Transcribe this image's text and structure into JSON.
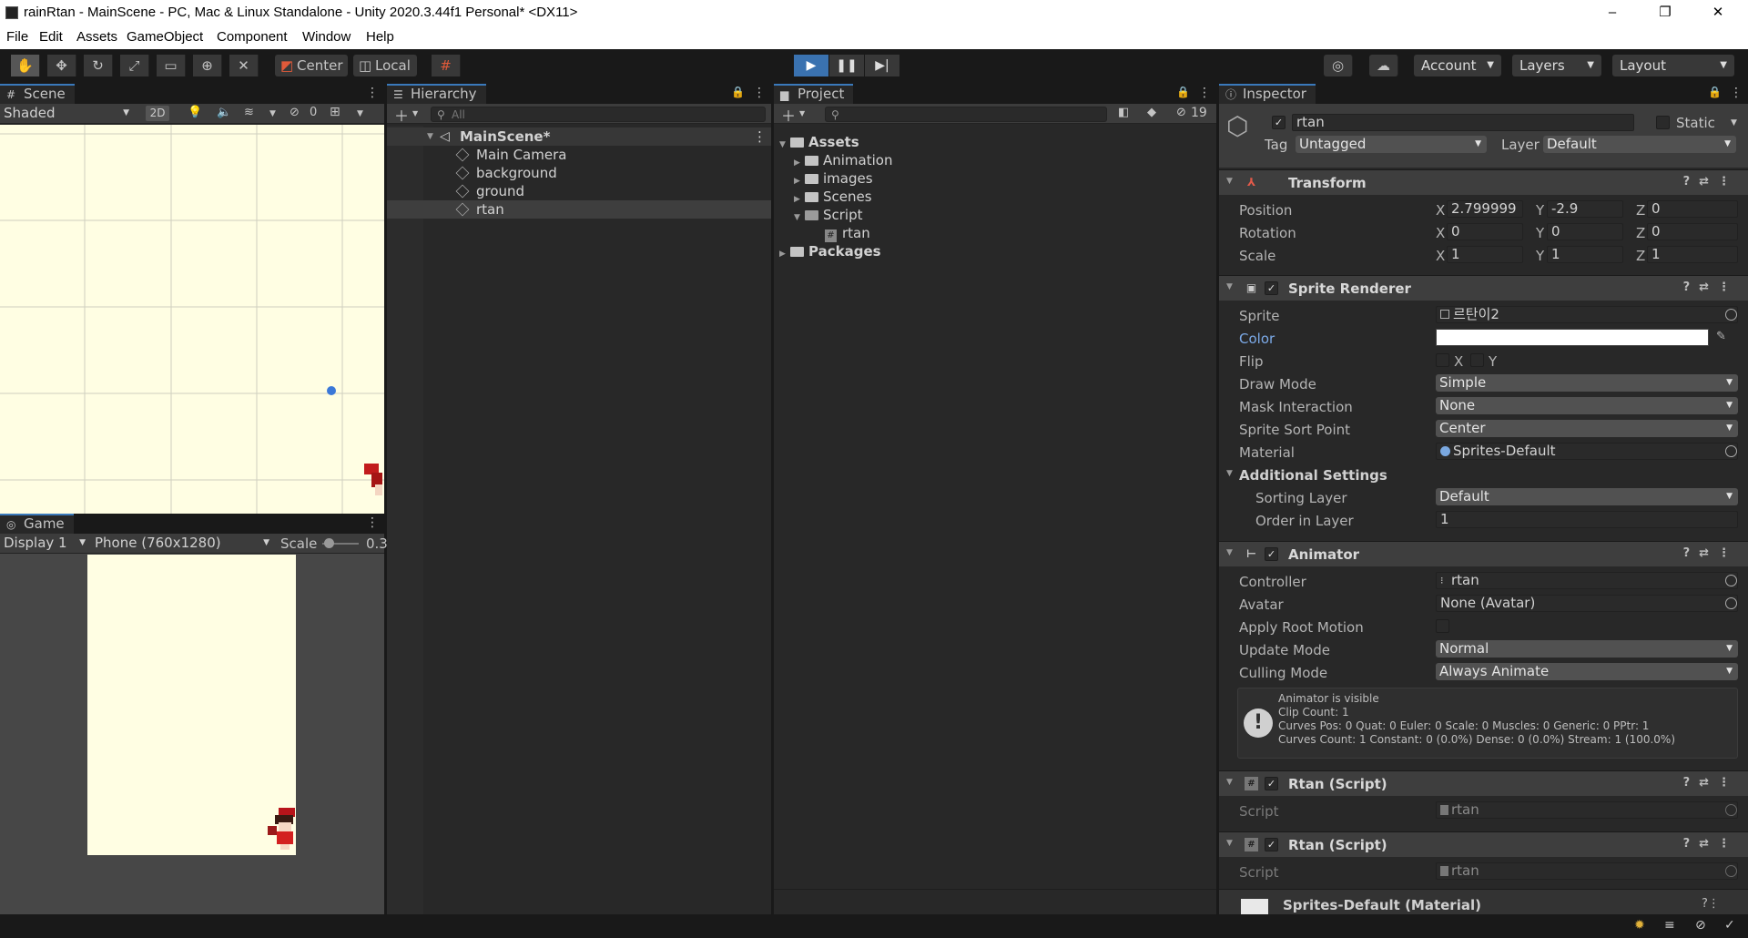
{
  "window": {
    "title": "rainRtan - MainScene - PC, Mac & Linux Standalone - Unity 2020.3.44f1 Personal* <DX11>",
    "minimize": "–",
    "maximize": "❐",
    "close": "✕"
  },
  "menu": [
    "File",
    "Edit",
    "Assets",
    "GameObject",
    "Component",
    "Window",
    "Help"
  ],
  "toolbar": {
    "pivot_center": "Center",
    "pivot_local": "Local",
    "account": "Account",
    "layers": "Layers",
    "layout": "Layout"
  },
  "scene": {
    "tab": "Scene",
    "shading": "Shaded",
    "mode_2d": "2D",
    "hidden_count": "0",
    "bg_color": "#fffee3"
  },
  "game": {
    "tab": "Game",
    "display": "Display 1",
    "resolution": "Phone (760x1280)",
    "scale_label": "Scale",
    "scale_value": "0.3"
  },
  "hierarchy": {
    "tab": "Hierarchy",
    "search_placeholder": "All",
    "scene_name": "MainScene*",
    "objects": [
      "Main Camera",
      "background",
      "ground",
      "rtan"
    ],
    "selected": "rtan"
  },
  "project": {
    "tab": "Project",
    "hidden_count": "19",
    "tree": {
      "assets": "Assets",
      "folders": [
        "Animation",
        "images",
        "Scenes",
        "Script"
      ],
      "script_child": "rtan",
      "packages": "Packages"
    }
  },
  "inspector": {
    "tab": "Inspector",
    "object_name": "rtan",
    "static_label": "Static",
    "tag_label": "Tag",
    "tag_value": "Untagged",
    "layer_label": "Layer",
    "layer_value": "Default",
    "transform": {
      "title": "Transform",
      "position_label": "Position",
      "rotation_label": "Rotation",
      "scale_label": "Scale",
      "position": [
        "2.799999",
        "-2.9",
        "0"
      ],
      "rotation": [
        "0",
        "0",
        "0"
      ],
      "scale": [
        "1",
        "1",
        "1"
      ]
    },
    "sprite_renderer": {
      "title": "Sprite Renderer",
      "sprite_label": "Sprite",
      "sprite_value": "르탄이2",
      "color_label": "Color",
      "flip_label": "Flip",
      "flip_x": "X",
      "flip_y": "Y",
      "draw_mode_label": "Draw Mode",
      "draw_mode": "Simple",
      "mask_label": "Mask Interaction",
      "mask": "None",
      "sort_point_label": "Sprite Sort Point",
      "sort_point": "Center",
      "material_label": "Material",
      "material": "Sprites-Default",
      "additional_label": "Additional Settings",
      "sorting_layer_label": "Sorting Layer",
      "sorting_layer": "Default",
      "order_label": "Order in Layer",
      "order": "1"
    },
    "animator": {
      "title": "Animator",
      "controller_label": "Controller",
      "controller": "rtan",
      "avatar_label": "Avatar",
      "avatar": "None (Avatar)",
      "root_motion_label": "Apply Root Motion",
      "update_mode_label": "Update Mode",
      "update_mode": "Normal",
      "culling_label": "Culling Mode",
      "culling": "Always Animate",
      "info": [
        "Animator is visible",
        "Clip Count: 1",
        "Curves Pos: 0 Quat: 0 Euler: 0 Scale: 0 Muscles: 0 Generic: 0 PPtr: 1",
        "Curves Count: 1 Constant: 0 (0.0%) Dense: 0 (0.0%) Stream: 1 (100.0%)"
      ]
    },
    "scripts": [
      {
        "title": "Rtan (Script)",
        "script_label": "Script",
        "script_value": "rtan"
      },
      {
        "title": "Rtan (Script)",
        "script_label": "Script",
        "script_value": "rtan"
      }
    ],
    "material_footer": "Sprites-Default (Material)"
  }
}
